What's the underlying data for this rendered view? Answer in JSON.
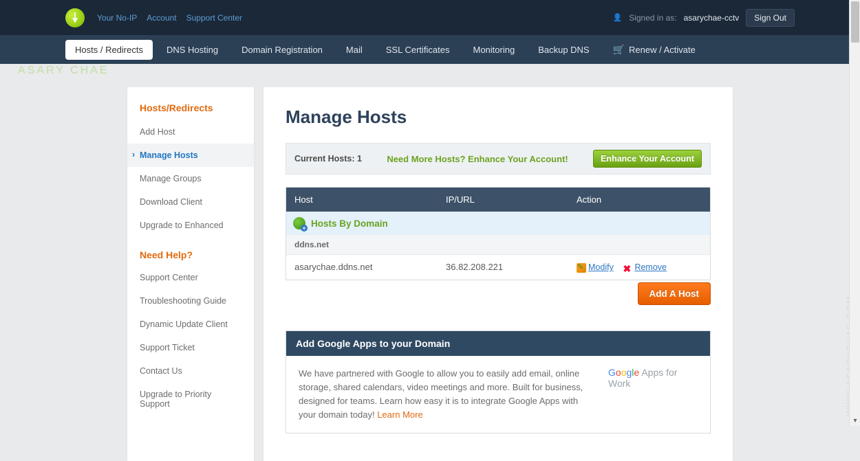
{
  "top": {
    "links": [
      "Your No-IP",
      "Account",
      "Support Center"
    ],
    "signed_label": "Signed in as:",
    "username": "asarychae-cctv",
    "signout": "Sign Out"
  },
  "nav": {
    "tabs": [
      "Hosts / Redirects",
      "DNS Hosting",
      "Domain Registration",
      "Mail",
      "SSL Certificates",
      "Monitoring",
      "Backup DNS",
      "Renew / Activate"
    ]
  },
  "sidebar": {
    "section1_title": "Hosts/Redirects",
    "items1": [
      "Add Host",
      "Manage Hosts",
      "Manage Groups",
      "Download Client",
      "Upgrade to Enhanced"
    ],
    "help_title": "Need Help?",
    "items2": [
      "Support Center",
      "Troubleshooting Guide",
      "Dynamic Update Client",
      "Support Ticket",
      "Contact Us",
      "Upgrade to Priority Support"
    ]
  },
  "main": {
    "title": "Manage Hosts",
    "current_label": "Current Hosts:",
    "current_count": "1",
    "need_more": "Need More Hosts? Enhance Your Account!",
    "enhance_btn": "Enhance Your Account",
    "cols": {
      "host": "Host",
      "ip": "IP/URL",
      "action": "Action"
    },
    "hosts_by_domain": "Hosts By Domain",
    "domain_group": "ddns.net",
    "row": {
      "host": "asarychae.ddns.net",
      "ip": "36.82.208.221",
      "modify": "Modify",
      "remove": "Remove"
    },
    "add_host_btn": "Add A Host"
  },
  "gapps": {
    "header": "Add Google Apps to your Domain",
    "body": "We have partnered with Google to allow you to easily add email, online storage, shared calendars, video meetings and more. Built for business, designed for teams. Learn how easy it is to integrate Google Apps with your domain today!",
    "link": "Learn More",
    "logo_suffix": " Apps for Work"
  },
  "watermarks": {
    "left": "ASARY CHAE",
    "right": "WWW.ASARYCHAE.COM"
  }
}
